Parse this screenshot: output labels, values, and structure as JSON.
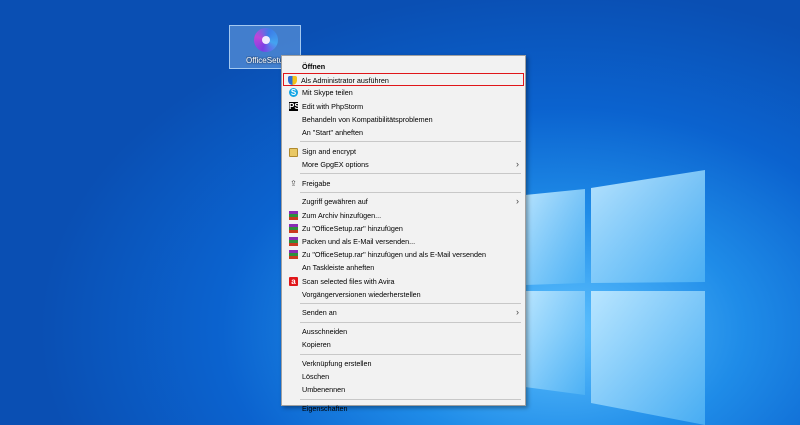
{
  "desktop": {
    "icon_label": "OfficeSetup"
  },
  "context_menu": {
    "groups": [
      [
        {
          "label": "Öffnen",
          "icon": null,
          "bold": true
        },
        {
          "label": "Als Administrator ausführen",
          "icon": "shield-icon",
          "highlighted": true
        },
        {
          "label": "Mit Skype teilen",
          "icon": "skype-icon"
        },
        {
          "label": "Edit with PhpStorm",
          "icon": "phpstorm-icon"
        },
        {
          "label": "Behandeln von Kompatibilitätsproblemen",
          "icon": null
        },
        {
          "label": "An \"Start\" anheften",
          "icon": null
        }
      ],
      [
        {
          "label": "Sign and encrypt",
          "icon": "lock-icon"
        },
        {
          "label": "More GpgEX options",
          "icon": null,
          "submenu": true
        }
      ],
      [
        {
          "label": "Freigabe",
          "icon": "share-icon"
        }
      ],
      [
        {
          "label": "Zugriff gewähren auf",
          "icon": null,
          "submenu": true
        },
        {
          "label": "Zum Archiv hinzufügen...",
          "icon": "winrar-icon"
        },
        {
          "label": "Zu \"OfficeSetup.rar\" hinzufügen",
          "icon": "winrar-icon"
        },
        {
          "label": "Packen und als E-Mail versenden...",
          "icon": "winrar-icon"
        },
        {
          "label": "Zu \"OfficeSetup.rar\" hinzufügen und als E-Mail versenden",
          "icon": "winrar-icon"
        },
        {
          "label": "An Taskleiste anheften",
          "icon": null
        },
        {
          "label": "Scan selected files with Avira",
          "icon": "avira-icon"
        },
        {
          "label": "Vorgängerversionen wiederherstellen",
          "icon": null
        }
      ],
      [
        {
          "label": "Senden an",
          "icon": null,
          "submenu": true
        }
      ],
      [
        {
          "label": "Ausschneiden",
          "icon": null
        },
        {
          "label": "Kopieren",
          "icon": null
        }
      ],
      [
        {
          "label": "Verknüpfung erstellen",
          "icon": null
        },
        {
          "label": "Löschen",
          "icon": null
        },
        {
          "label": "Umbenennen",
          "icon": null
        }
      ],
      [
        {
          "label": "Eigenschaften",
          "icon": null
        }
      ]
    ],
    "submenu_arrow": "›",
    "highlight_color": "#e0161a"
  }
}
